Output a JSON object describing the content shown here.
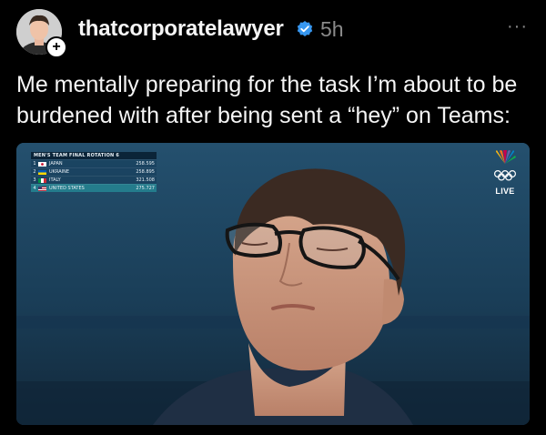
{
  "post": {
    "username": "thatcorporatelawyer",
    "timestamp": "5h",
    "more_label": "···",
    "follow_badge": "+",
    "caption": "Me mentally preparing for the task I’m about to be burdened with after being sent a “hey” on Teams:"
  },
  "media": {
    "scoreboard": {
      "title": "MEN'S TEAM FINAL  ROTATION 6",
      "rows": [
        {
          "rank": "1",
          "country": "JAPAN",
          "score": "258.595",
          "flag": "japan-flag"
        },
        {
          "rank": "2",
          "country": "UKRAINE",
          "score": "258.895",
          "flag": "ukraine-flag"
        },
        {
          "rank": "3",
          "country": "ITALY",
          "score": "321.508",
          "flag": "italy-flag"
        },
        {
          "rank": "4",
          "country": "UNITED STATES",
          "score": "275.727",
          "flag": "usa-flag"
        }
      ]
    },
    "live_label": "LIVE",
    "network_icon": "peacock-icon",
    "rings_icon": "olympic-rings-icon"
  },
  "colors": {
    "background": "#000000",
    "verified_blue": "#3797f0",
    "muted_text": "#8a8a8a"
  }
}
